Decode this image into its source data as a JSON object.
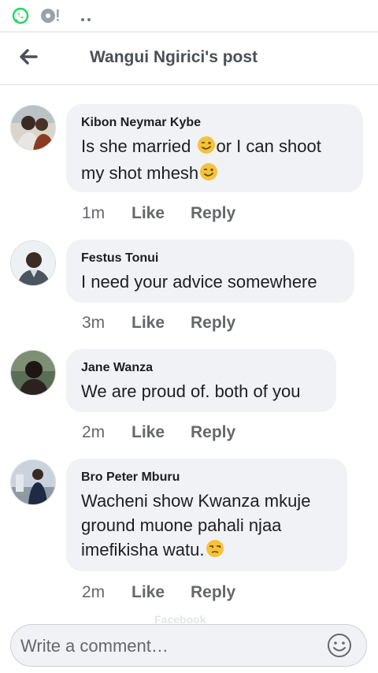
{
  "header": {
    "title": "Wangui Ngirici's post"
  },
  "comments": [
    {
      "name": "Kibon Neymar Kybe",
      "text1": "Is she married ",
      "text2": "or I can shoot",
      "text3": "my shot mhesh",
      "time": "1m",
      "like": "Like",
      "reply": "Reply"
    },
    {
      "name": "Festus Tonui",
      "text": "I need your advice somewhere",
      "time": "3m",
      "like": "Like",
      "reply": "Reply"
    },
    {
      "name": "Jane Wanza",
      "text": "We are proud of. both of you",
      "time": "2m",
      "like": "Like",
      "reply": "Reply"
    },
    {
      "name": "Bro Peter Mburu",
      "line1": "Wacheni show Kwanza mkuje",
      "line2": "ground muone pahali njaa",
      "line3": "imefikisha watu.",
      "time": "2m",
      "like": "Like",
      "reply": "Reply"
    }
  ],
  "composer": {
    "placeholder": "Write a comment…"
  },
  "watermark": "Facebook",
  "icons": {
    "status": [
      "whatsapp-icon",
      "disc-alert-icon",
      "more-dots-icon"
    ],
    "back": "back-arrow-icon",
    "emoji_wink": "winking-face-icon",
    "emoji_unamused": "unamused-face-icon",
    "composer": "smiley-icon"
  },
  "colors": {
    "bubble": "#f0f2f5",
    "meta": "#65676b",
    "title": "#4b4f56",
    "whatsapp": "#25d366"
  }
}
